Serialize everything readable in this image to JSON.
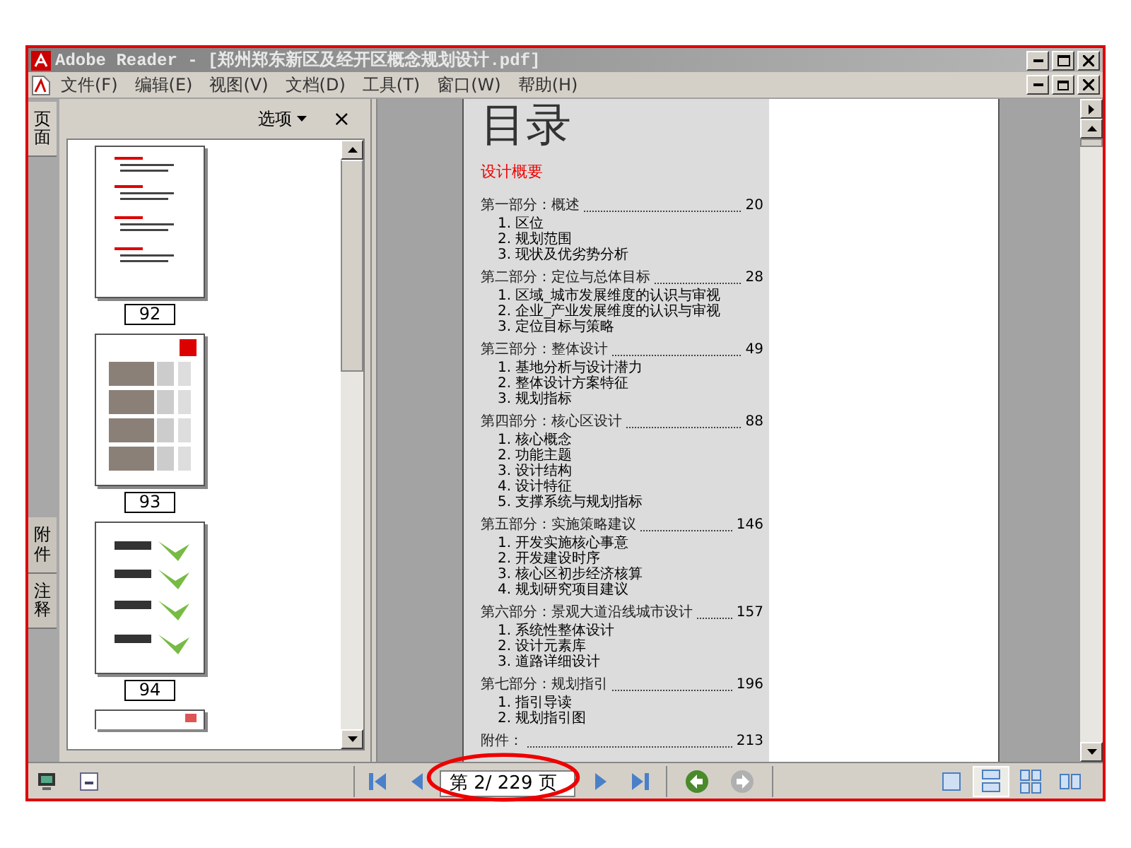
{
  "window": {
    "title": "Adobe Reader - [郑州郑东新区及经开区概念规划设计.pdf]"
  },
  "menu": [
    {
      "label": "文件(F)"
    },
    {
      "label": "编辑(E)"
    },
    {
      "label": "视图(V)"
    },
    {
      "label": "文档(D)"
    },
    {
      "label": "工具(T)"
    },
    {
      "label": "窗口(W)"
    },
    {
      "label": "帮助(H)"
    }
  ],
  "side_tabs": [
    {
      "label": "页面",
      "selected": true
    },
    {
      "label": "附件",
      "selected": false
    },
    {
      "label": "注释",
      "selected": false
    }
  ],
  "panel": {
    "options": "选项",
    "close": "×",
    "thumbnails": [
      {
        "label": "92",
        "kind": "text"
      },
      {
        "label": "93",
        "kind": "photos"
      },
      {
        "label": "94",
        "kind": "maps"
      },
      {
        "kind": "partial"
      }
    ]
  },
  "document": {
    "title": "目录",
    "subtitle": "设计概要",
    "sections": [
      {
        "heading": "第一部分：概述",
        "page": "20",
        "items": [
          "1. 区位",
          "2. 规划范围",
          "3. 现状及优劣势分析"
        ]
      },
      {
        "heading": "第二部分：定位与总体目标",
        "page": "28",
        "items": [
          "1. 区域_城市发展维度的认识与审视",
          "2. 企业_产业发展维度的认识与审视",
          "3. 定位目标与策略"
        ]
      },
      {
        "heading": "第三部分：整体设计",
        "page": "49",
        "items": [
          "1. 基地分析与设计潜力",
          "2. 整体设计方案特征",
          "3. 规划指标"
        ]
      },
      {
        "heading": "第四部分：核心区设计",
        "page": "88",
        "items": [
          "1. 核心概念",
          "2. 功能主题",
          "3. 设计结构",
          "4. 设计特征",
          "5. 支撑系统与规划指标"
        ]
      },
      {
        "heading": "第五部分：实施策略建议",
        "page": "146",
        "items": [
          "1. 开发实施核心事意",
          "2. 开发建设时序",
          "3. 核心区初步经济核算",
          "4. 规划研究项目建议"
        ]
      },
      {
        "heading": "第六部分：景观大道沿线城市设计",
        "page": "157",
        "items": [
          "1. 系统性整体设计",
          "2. 设计元素库",
          "3. 道路详细设计"
        ]
      },
      {
        "heading": "第七部分：规划指引",
        "page": "196",
        "items": [
          "1. 指引导读",
          "2. 规划指引图"
        ]
      },
      {
        "heading": "附件：",
        "page": "213"
      }
    ]
  },
  "toolbar": {
    "page_field": "第 2/ 229 页",
    "views": [
      {
        "kind": "single",
        "selected": false
      },
      {
        "kind": "continuous",
        "selected": true
      },
      {
        "kind": "facing-continuous",
        "selected": false
      },
      {
        "kind": "facing",
        "selected": false
      }
    ]
  }
}
